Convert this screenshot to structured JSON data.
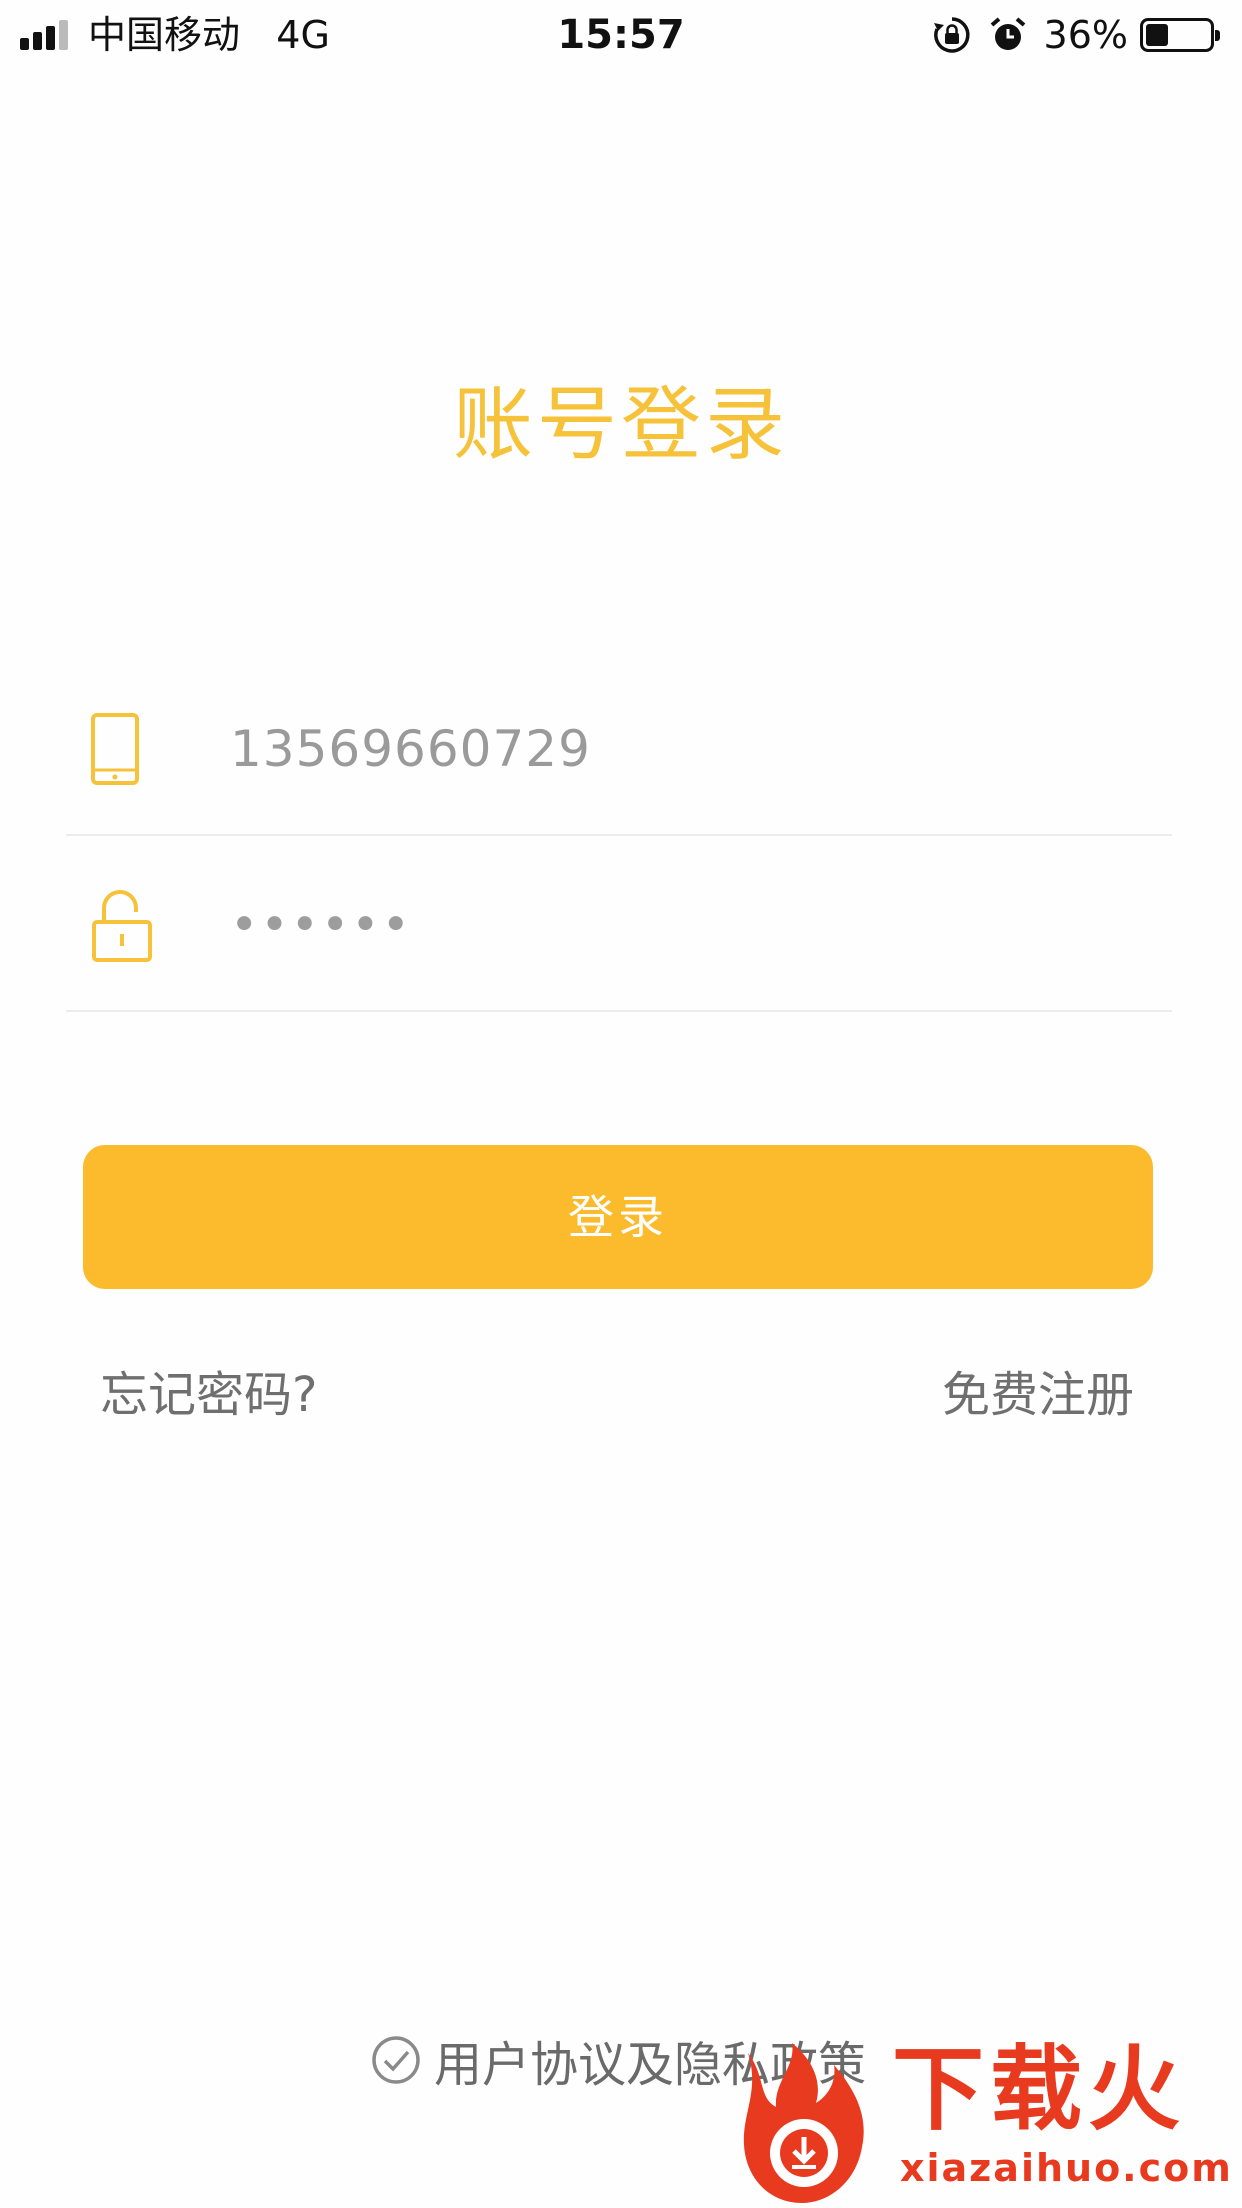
{
  "status_bar": {
    "carrier": "中国移动",
    "network": "4G",
    "time": "15:57",
    "battery_percent": "36%",
    "battery_level": 0.36,
    "icons": [
      "signal-icon",
      "rotation-lock-icon",
      "alarm-icon",
      "battery-icon"
    ]
  },
  "title": "账号登录",
  "form": {
    "phone_value": "13569660729",
    "password_value": "••••••",
    "phone_icon": "phone-icon",
    "lock_icon": "lock-icon"
  },
  "login_button": "登录",
  "links": {
    "forgot": "忘记密码?",
    "register": "免费注册"
  },
  "agreement": {
    "text": "用户协议及隐私政策",
    "icon": "check-circle-icon"
  },
  "watermark": {
    "brand": "下载火",
    "url": "xiazaihuo.com"
  },
  "colors": {
    "accent": "#fbbb2d",
    "title": "#f5c23a",
    "watermark": "#e83a1f"
  }
}
